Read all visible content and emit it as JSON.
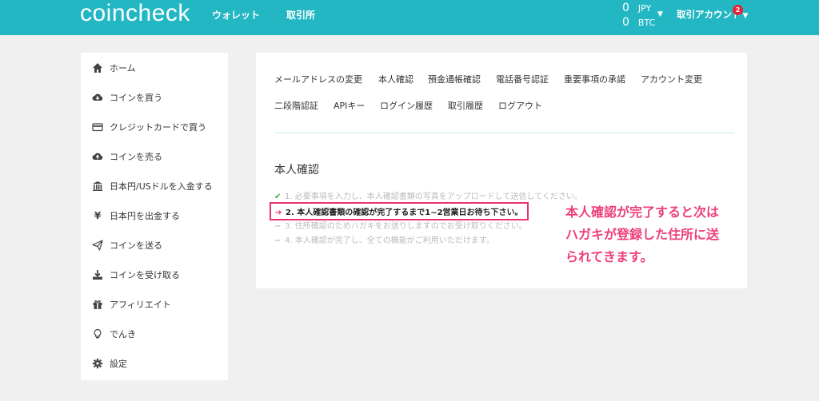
{
  "header": {
    "logo": "coincheck",
    "nav": {
      "wallet": "ウォレット",
      "trade": "取引所"
    },
    "balances": [
      {
        "amount": "0",
        "currency": "JPY"
      },
      {
        "amount": "0",
        "currency": "BTC"
      }
    ],
    "account": "取引アカウント",
    "notification_count": "2"
  },
  "sidebar": {
    "items": [
      {
        "label": "ホーム",
        "icon": "home-icon"
      },
      {
        "label": "コインを買う",
        "icon": "cloud-download-icon"
      },
      {
        "label": "クレジットカードで買う",
        "icon": "credit-card-icon"
      },
      {
        "label": "コインを売る",
        "icon": "cloud-upload-icon"
      },
      {
        "label": "日本円/USドルを入金する",
        "icon": "bank-icon"
      },
      {
        "label": "日本円を出金する",
        "icon": "yen-icon"
      },
      {
        "label": "コインを送る",
        "icon": "paper-plane-icon"
      },
      {
        "label": "コインを受け取る",
        "icon": "download-tray-icon"
      },
      {
        "label": "アフィリエイト",
        "icon": "gift-icon"
      },
      {
        "label": "でんき",
        "icon": "lightbulb-icon"
      },
      {
        "label": "設定",
        "icon": "gear-icon"
      }
    ]
  },
  "tabs": {
    "row1": [
      "メールアドレスの変更",
      "本人確認",
      "預金通帳確認",
      "電話番号認証",
      "重要事項の承諾",
      "アカウント変更"
    ],
    "row2": [
      "二段階認証",
      "APIキー",
      "ログイン履歴",
      "取引履歴",
      "ログアウト"
    ]
  },
  "verification": {
    "title": "本人確認",
    "steps": [
      {
        "mark": "✔",
        "text": "1. 必要事項を入力し、本人確認書類の写真をアップロードして送信してください。",
        "state": "done"
      },
      {
        "mark": "➔",
        "text": "2. 本人確認書類の確認が完了するまで1~2営業日お待ち下さい。",
        "state": "current"
      },
      {
        "mark": "−",
        "text": "3. 住所確認のためハガキをお送りしますのでお受け取りください。",
        "state": "pending"
      },
      {
        "mark": "−",
        "text": "4. 本人確認が完了し、全ての機能がご利用いただけます。",
        "state": "pending"
      }
    ]
  },
  "annotation": {
    "lines": [
      "本人確認が完了すると次は",
      "ハガキが登録した住所に送",
      "られてきます。"
    ]
  },
  "colors": {
    "header": "#23b7c4",
    "highlight": "#e8336d",
    "annotation": "#ee3f7b",
    "check": "#3fa63f"
  }
}
